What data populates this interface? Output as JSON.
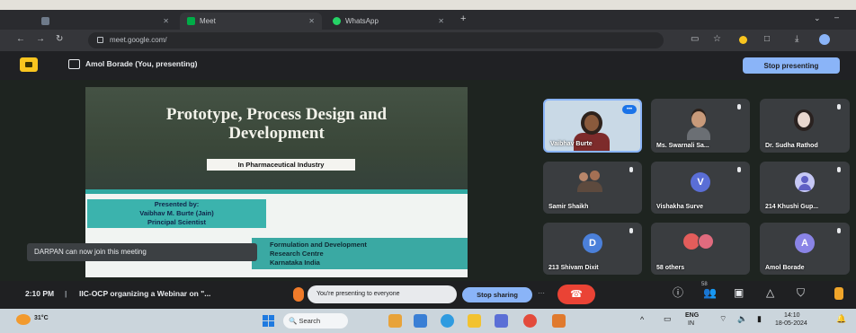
{
  "browser": {
    "tabs": [
      {
        "label": ""
      },
      {
        "label": "Meet"
      },
      {
        "label": "WhatsApp"
      }
    ],
    "url": "meet.google.com/"
  },
  "meet": {
    "presenter_label": "Amol Borade (You, presenting)",
    "stop_presenting": "Stop presenting"
  },
  "slide": {
    "title_line1": "Prototype, Process Design and",
    "title_line2": "Development",
    "subtitle": "In Pharmaceutical Industry",
    "presented_by": "Presented by:",
    "presenter_name": "Vaibhav M. Burte (Jain)",
    "presenter_role": "Principal Scientist",
    "affiliation": [
      "Formulation and Development",
      "Research Centre",
      "Karnataka India"
    ]
  },
  "toast": "DARPAN can now join this meeting",
  "participants": [
    {
      "name": "Vaibhav Burte"
    },
    {
      "name": "Ms. Swarnali Sa..."
    },
    {
      "name": "Dr. Sudha Rathod"
    },
    {
      "name": "Samir Shaikh"
    },
    {
      "name": "Vishakha Surve",
      "initial": "V",
      "avatar_color": "#5a6ed6"
    },
    {
      "name": "214 Khushi Gup..."
    },
    {
      "name": "213 Shivam Dixit",
      "initial": "D",
      "avatar_color": "#4b80da"
    },
    {
      "name": "58 others"
    },
    {
      "name": "Amol Borade",
      "initial": "A",
      "avatar_color": "#8a84e6"
    }
  ],
  "bottom": {
    "time": "2:10 PM",
    "separator": "|",
    "meeting_title": "IIC-OCP organizing a Webinar on \"...",
    "notice": "You're presenting to everyone",
    "stop_sharing": "Stop sharing",
    "people_count": "58"
  },
  "taskbar": {
    "weather": "31°C",
    "search": "Search",
    "lang": "ENG",
    "region": "IN",
    "time": "14:10",
    "date": "18-05-2024"
  },
  "colors": {
    "accent": "#8ab4f8",
    "hangup": "#ea4335",
    "meet_logo": "#f9c51f",
    "slide_teal": "#2fa9a2"
  }
}
